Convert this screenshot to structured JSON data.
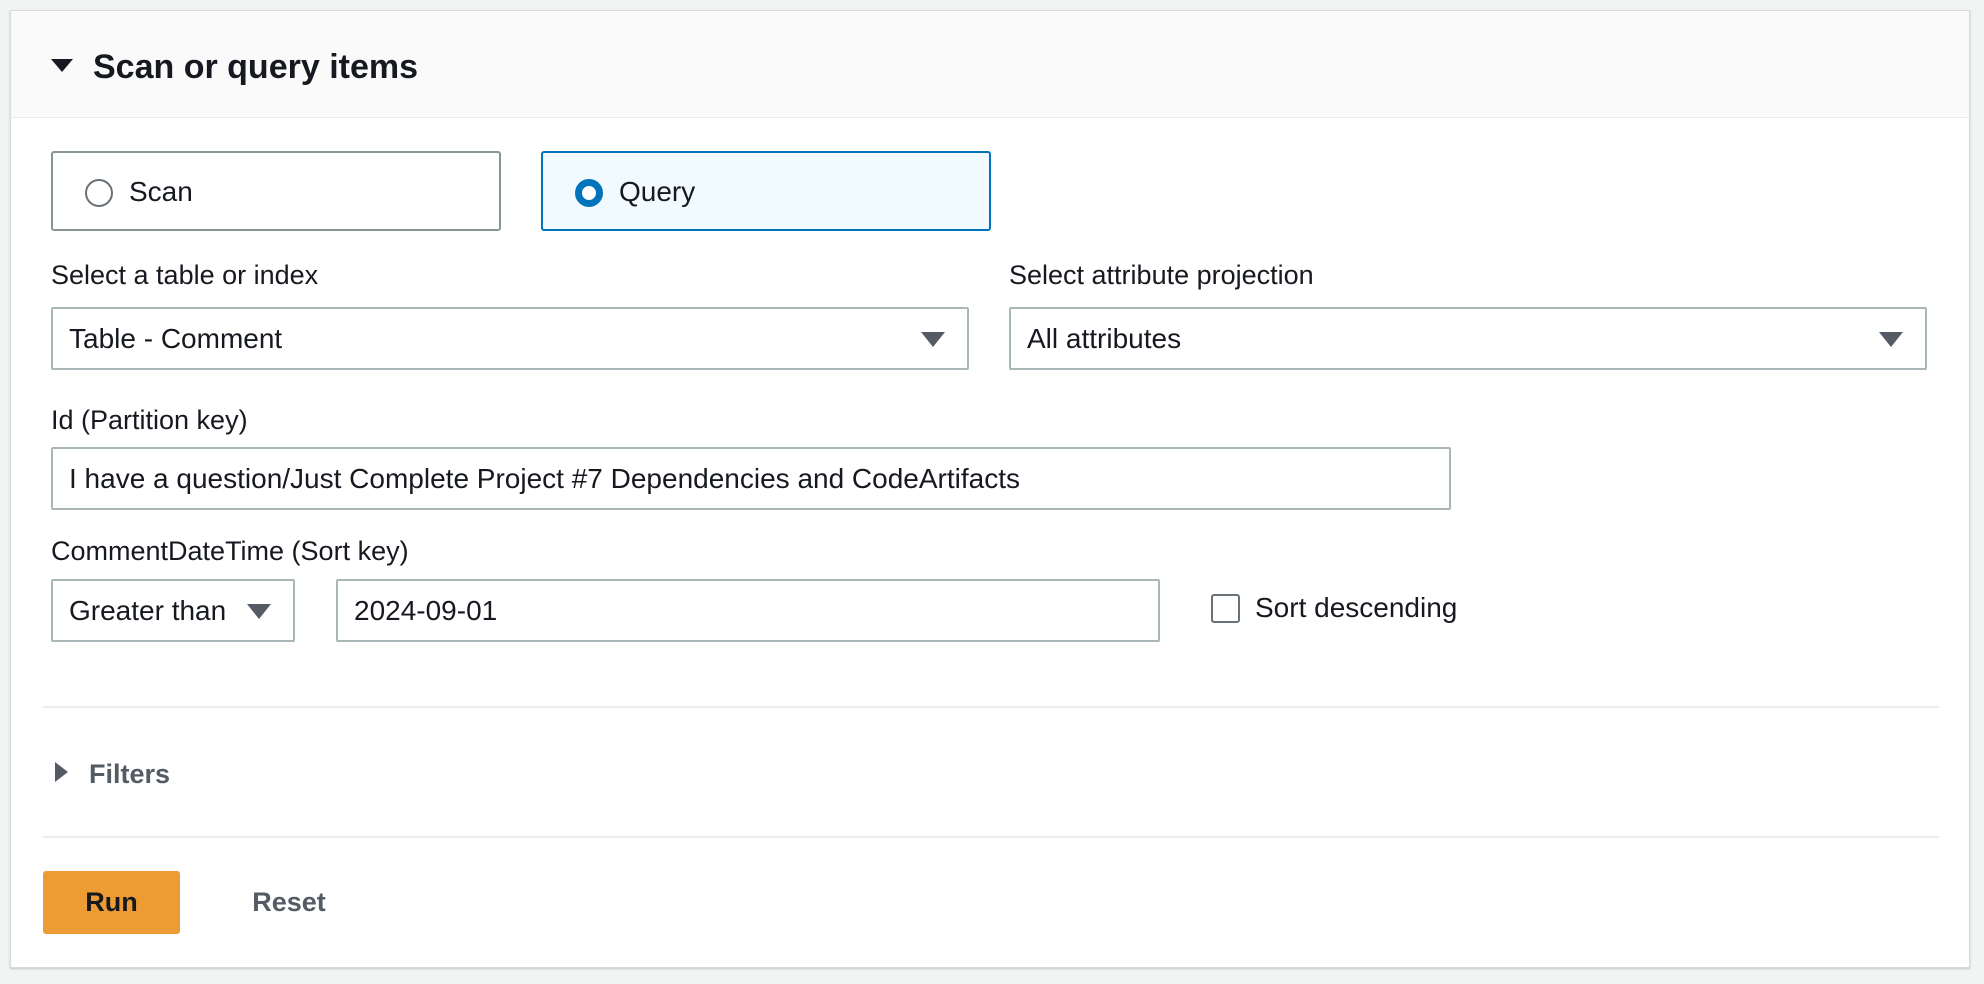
{
  "panel": {
    "title": "Scan or query items"
  },
  "mode": {
    "options": [
      {
        "label": "Scan",
        "selected": false
      },
      {
        "label": "Query",
        "selected": true
      }
    ]
  },
  "table_select": {
    "label": "Select a table or index",
    "value": "Table - Comment"
  },
  "projection_select": {
    "label": "Select attribute projection",
    "value": "All attributes"
  },
  "partition_key": {
    "label": "Id (Partition key)",
    "value": "I have a question/Just Complete Project #7 Dependencies and CodeArtifacts"
  },
  "sort_key": {
    "label": "CommentDateTime (Sort key)",
    "operator": "Greater than",
    "value": "2024-09-01",
    "descending_label": "Sort descending",
    "descending_checked": false
  },
  "filters": {
    "label": "Filters"
  },
  "actions": {
    "run_label": "Run",
    "reset_label": "Reset"
  },
  "colors": {
    "accent": "#0073bb",
    "run_button": "#ec9c33"
  }
}
